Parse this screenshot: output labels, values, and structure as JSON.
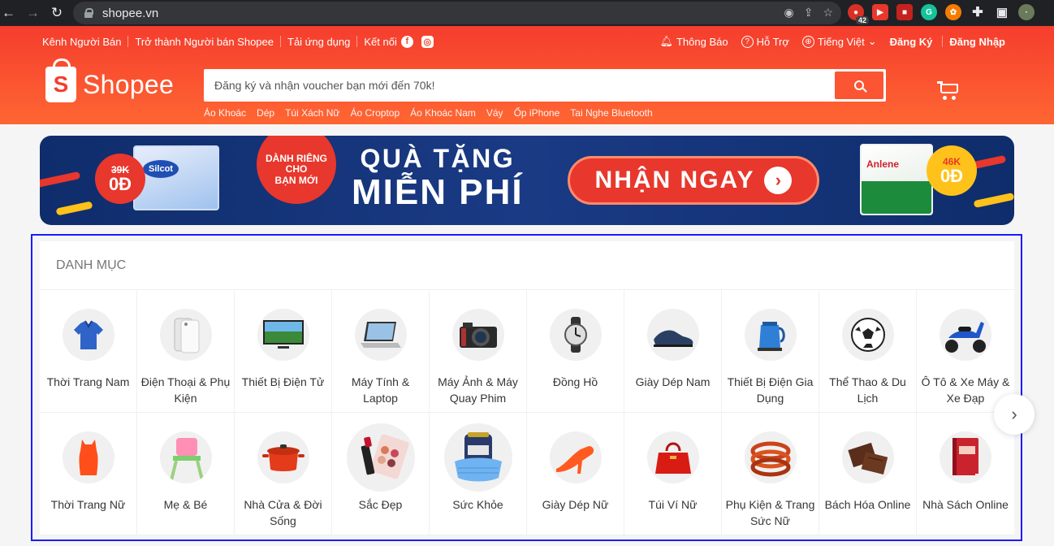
{
  "browser": {
    "url": "shopee.vn",
    "extension_badge": "42"
  },
  "topbar": {
    "left": [
      "Kênh Người Bán",
      "Trở thành Người bán Shopee",
      "Tải ứng dụng",
      "Kết nối"
    ],
    "notifications": "Thông Báo",
    "support": "Hỗ Trợ",
    "language": "Tiếng Việt",
    "register": "Đăng Ký",
    "login": "Đăng Nhập"
  },
  "logo": {
    "text": "Shopee"
  },
  "search": {
    "placeholder": "Đăng ký và nhận voucher bạn mới đến 70k!",
    "suggestions": [
      "Áo Khoác",
      "Dép",
      "Túi Xách Nữ",
      "Áo Croptop",
      "Áo Khoác Nam",
      "Váy",
      "Ốp iPhone",
      "Tai Nghe Bluetooth"
    ]
  },
  "banner": {
    "left_old_price": "39K",
    "left_new_price": "0Đ",
    "left_brand": "Silcot",
    "new_user_1": "DÀNH RIÊNG",
    "new_user_2": "CHO",
    "new_user_3": "BẠN MỚI",
    "gift_line_1": "QUÀ TẶNG",
    "gift_line_2": "MIỄN PHÍ",
    "cta": "NHẬN NGAY",
    "right_old_price": "46K",
    "right_new_price": "0Đ",
    "right_brand": "Anlene"
  },
  "category": {
    "title": "DANH MỤC",
    "items": [
      {
        "label": "Thời Trang Nam",
        "icon": "polo-shirt-icon"
      },
      {
        "label": "Điện Thoại & Phụ Kiện",
        "icon": "smartphone-icon"
      },
      {
        "label": "Thiết Bị Điện Tử",
        "icon": "television-icon"
      },
      {
        "label": "Máy Tính & Laptop",
        "icon": "laptop-icon"
      },
      {
        "label": "Máy Ảnh & Máy Quay Phim",
        "icon": "camera-icon"
      },
      {
        "label": "Đồng Hồ",
        "icon": "watch-icon"
      },
      {
        "label": "Giày Dép Nam",
        "icon": "men-shoe-icon"
      },
      {
        "label": "Thiết Bị Điện Gia Dụng",
        "icon": "kettle-icon"
      },
      {
        "label": "Thể Thao & Du Lịch",
        "icon": "soccer-ball-icon"
      },
      {
        "label": "Ô Tô & Xe Máy & Xe Đạp",
        "icon": "scooter-icon"
      },
      {
        "label": "Thời Trang Nữ",
        "icon": "women-top-icon"
      },
      {
        "label": "Mẹ & Bé",
        "icon": "high-chair-icon"
      },
      {
        "label": "Nhà Cửa & Đời Sống",
        "icon": "cooking-pot-icon"
      },
      {
        "label": "Sắc Đẹp",
        "icon": "makeup-palette-icon"
      },
      {
        "label": "Sức Khỏe",
        "icon": "face-mask-icon"
      },
      {
        "label": "Giày Dép Nữ",
        "icon": "high-heel-icon"
      },
      {
        "label": "Túi Ví Nữ",
        "icon": "handbag-icon"
      },
      {
        "label": "Phụ Kiện & Trang Sức Nữ",
        "icon": "bracelet-icon"
      },
      {
        "label": "Bách Hóa Online",
        "icon": "chocolate-icon"
      },
      {
        "label": "Nhà Sách Online",
        "icon": "book-icon"
      }
    ]
  },
  "colors": {
    "brand": "#ee4d2d",
    "highlight": "#1a1aff"
  }
}
